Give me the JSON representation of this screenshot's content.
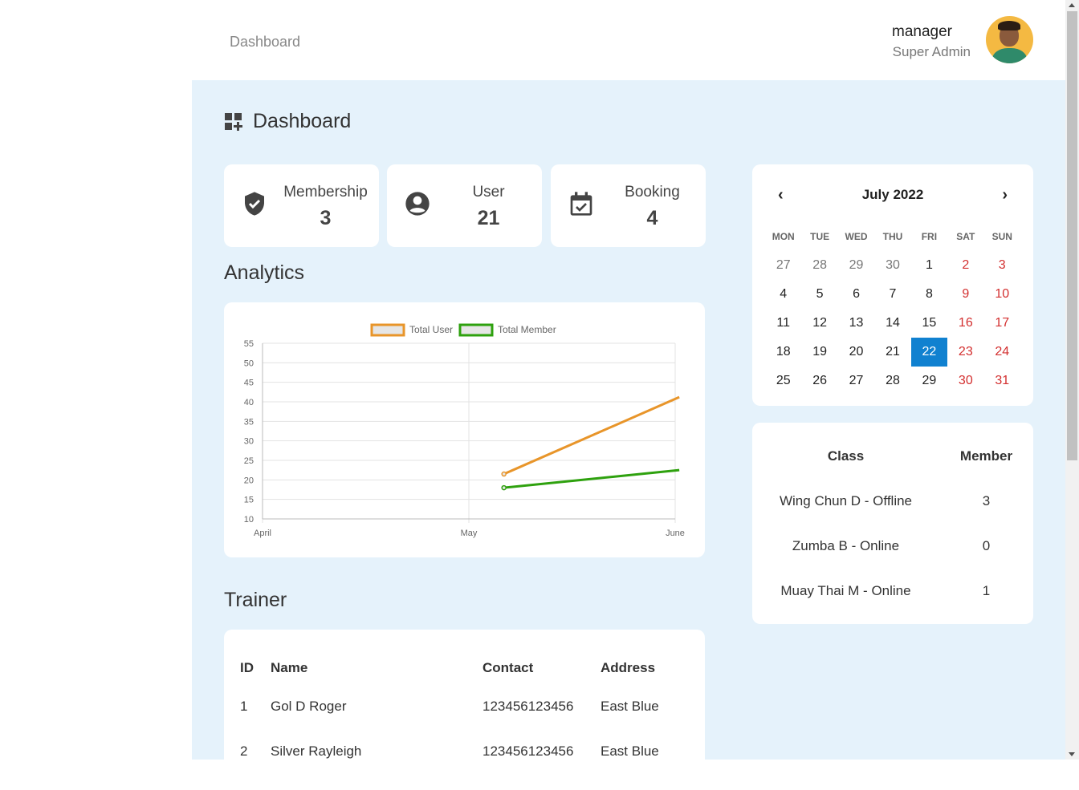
{
  "header": {
    "breadcrumb": "Dashboard",
    "user_name": "manager",
    "user_role": "Super Admin"
  },
  "page_title": "Dashboard",
  "stats": [
    {
      "label": "Membership",
      "value": "3",
      "icon": "shield-check-icon"
    },
    {
      "label": "User",
      "value": "21",
      "icon": "account-circle-icon"
    },
    {
      "label": "Booking",
      "value": "4",
      "icon": "calendar-check-icon"
    }
  ],
  "analytics": {
    "title": "Analytics"
  },
  "chart_data": {
    "type": "line",
    "x": [
      "April",
      "May",
      "June"
    ],
    "ylim": [
      10,
      55
    ],
    "yticks": [
      "55",
      "50",
      "45",
      "40",
      "35",
      "30",
      "25",
      "20",
      "15",
      "10"
    ],
    "legend_position": "top",
    "grid": true,
    "series": [
      {
        "name": "Total User",
        "color": "#e8952a",
        "points": [
          {
            "x": 1.17,
            "y": 21.5
          },
          {
            "x": 2.02,
            "y": 41.2
          }
        ]
      },
      {
        "name": "Total Member",
        "color": "#2ea10e",
        "points": [
          {
            "x": 1.17,
            "y": 18
          },
          {
            "x": 2.02,
            "y": 22.5
          }
        ]
      }
    ]
  },
  "trainer": {
    "title": "Trainer",
    "columns": [
      "ID",
      "Name",
      "Contact",
      "Address"
    ],
    "rows": [
      [
        "1",
        "Gol D Roger",
        "123456123456",
        "East Blue"
      ],
      [
        "2",
        "Silver Rayleigh",
        "123456123456",
        "East Blue"
      ]
    ]
  },
  "calendar": {
    "month_label": "July 2022",
    "prev": "‹",
    "next": "›",
    "weekdays": [
      "MON",
      "TUE",
      "WED",
      "THU",
      "FRI",
      "SAT",
      "SUN"
    ],
    "days": [
      {
        "d": "27",
        "other": true
      },
      {
        "d": "28",
        "other": true
      },
      {
        "d": "29",
        "other": true
      },
      {
        "d": "30",
        "other": true
      },
      {
        "d": "1"
      },
      {
        "d": "2",
        "weekend": true
      },
      {
        "d": "3",
        "weekend": true
      },
      {
        "d": "4"
      },
      {
        "d": "5"
      },
      {
        "d": "6"
      },
      {
        "d": "7"
      },
      {
        "d": "8"
      },
      {
        "d": "9",
        "weekend": true
      },
      {
        "d": "10",
        "weekend": true
      },
      {
        "d": "11"
      },
      {
        "d": "12"
      },
      {
        "d": "13"
      },
      {
        "d": "14"
      },
      {
        "d": "15"
      },
      {
        "d": "16",
        "weekend": true
      },
      {
        "d": "17",
        "weekend": true
      },
      {
        "d": "18"
      },
      {
        "d": "19"
      },
      {
        "d": "20"
      },
      {
        "d": "21"
      },
      {
        "d": "22",
        "selected": true
      },
      {
        "d": "23",
        "weekend": true
      },
      {
        "d": "24",
        "weekend": true
      },
      {
        "d": "25"
      },
      {
        "d": "26"
      },
      {
        "d": "27"
      },
      {
        "d": "28"
      },
      {
        "d": "29"
      },
      {
        "d": "30",
        "weekend": true
      },
      {
        "d": "31",
        "weekend": true
      }
    ]
  },
  "classes": {
    "columns": [
      "Class",
      "Member"
    ],
    "rows": [
      [
        "Wing Chun D - Offline",
        "3"
      ],
      [
        "Zumba B - Online",
        "0"
      ],
      [
        "Muay Thai M - Online",
        "1"
      ]
    ]
  },
  "colors": {
    "main_bg": "#e5f2fb",
    "selected_day": "#1081d0",
    "weekend": "#d32f2f"
  }
}
